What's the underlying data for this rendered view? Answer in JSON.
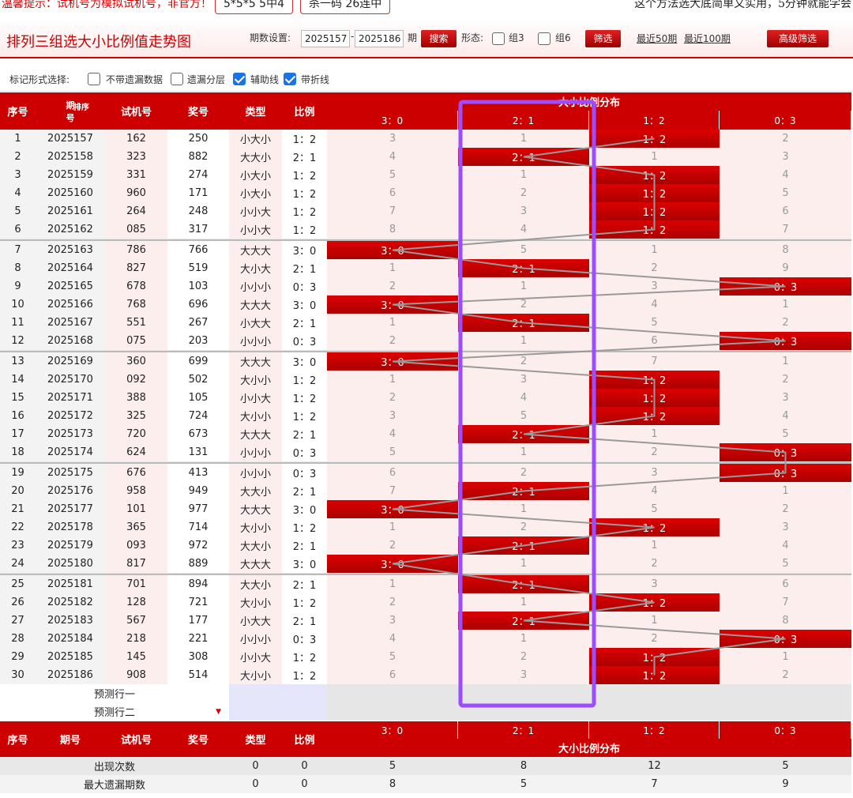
{
  "top": {
    "notice": "温馨提示：试机号为模拟试机号，非官方！",
    "pill1": "5*5*5 5中4",
    "pill2": "杀一码 26连中",
    "right": "这个方法选大底简单又实用，5分钟就能学会"
  },
  "header": {
    "title": "排列三组选大小比例值走势图",
    "period_label": "期数设置:",
    "from": "2025157",
    "dash": "-",
    "to": "2025186",
    "qi": "期",
    "search": "搜索",
    "form_label": "形态:",
    "group3": "组3",
    "group6": "组6",
    "filter": "筛选",
    "recent50": "最近50期",
    "recent100": "最近100期",
    "advanced": "高级筛选"
  },
  "marker": {
    "label": "标记形式选择:",
    "opt1": "不带遗漏数据",
    "opt2": "遗漏分层",
    "opt3": "辅助线",
    "opt4": "带折线",
    "checked": [
      false,
      false,
      true,
      true
    ]
  },
  "table": {
    "head": {
      "seq": "序号",
      "issue": "期",
      "issue2": "号",
      "sort": "排序",
      "trial": "试机号",
      "prize": "奖号",
      "type": "类型",
      "ratio": "比例",
      "dist": "大小比例分布",
      "cats": [
        "3：0",
        "2：1",
        "1：2",
        "0：3"
      ]
    },
    "rows": [
      [
        "1",
        "2025157",
        "162",
        "250",
        "小大小",
        "1：2",
        2,
        [
          3,
          1,
          null,
          2
        ]
      ],
      [
        "2",
        "2025158",
        "323",
        "882",
        "大大小",
        "2：1",
        1,
        [
          4,
          null,
          1,
          3
        ]
      ],
      [
        "3",
        "2025159",
        "331",
        "274",
        "小大小",
        "1：2",
        2,
        [
          5,
          1,
          null,
          4
        ]
      ],
      [
        "4",
        "2025160",
        "960",
        "171",
        "小大小",
        "1：2",
        2,
        [
          6,
          2,
          null,
          5
        ]
      ],
      [
        "5",
        "2025161",
        "264",
        "248",
        "小小大",
        "1：2",
        2,
        [
          7,
          3,
          null,
          6
        ]
      ],
      [
        "6",
        "2025162",
        "085",
        "317",
        "小小大",
        "1：2",
        2,
        [
          8,
          4,
          null,
          7
        ]
      ],
      [
        "7",
        "2025163",
        "786",
        "766",
        "大大大",
        "3：0",
        0,
        [
          null,
          5,
          1,
          8
        ]
      ],
      [
        "8",
        "2025164",
        "827",
        "519",
        "大小大",
        "2：1",
        1,
        [
          1,
          null,
          2,
          9
        ]
      ],
      [
        "9",
        "2025165",
        "678",
        "103",
        "小小小",
        "0：3",
        3,
        [
          2,
          1,
          3,
          null
        ]
      ],
      [
        "10",
        "2025166",
        "768",
        "696",
        "大大大",
        "3：0",
        0,
        [
          null,
          2,
          4,
          1
        ]
      ],
      [
        "11",
        "2025167",
        "551",
        "267",
        "小大大",
        "2：1",
        1,
        [
          1,
          null,
          5,
          2
        ]
      ],
      [
        "12",
        "2025168",
        "075",
        "203",
        "小小小",
        "0：3",
        3,
        [
          2,
          1,
          6,
          null
        ]
      ],
      [
        "13",
        "2025169",
        "360",
        "699",
        "大大大",
        "3：0",
        0,
        [
          null,
          2,
          7,
          1
        ]
      ],
      [
        "14",
        "2025170",
        "092",
        "502",
        "大小小",
        "1：2",
        2,
        [
          1,
          3,
          null,
          2
        ]
      ],
      [
        "15",
        "2025171",
        "388",
        "105",
        "小小大",
        "1：2",
        2,
        [
          2,
          4,
          null,
          3
        ]
      ],
      [
        "16",
        "2025172",
        "325",
        "724",
        "大小小",
        "1：2",
        2,
        [
          3,
          5,
          null,
          4
        ]
      ],
      [
        "17",
        "2025173",
        "720",
        "673",
        "大大大",
        "2：1",
        1,
        [
          4,
          null,
          1,
          5
        ]
      ],
      [
        "18",
        "2025174",
        "624",
        "131",
        "小小小",
        "0：3",
        3,
        [
          5,
          1,
          2,
          null
        ]
      ],
      [
        "19",
        "2025175",
        "676",
        "413",
        "小小小",
        "0：3",
        3,
        [
          6,
          2,
          3,
          null
        ]
      ],
      [
        "20",
        "2025176",
        "958",
        "949",
        "大大小",
        "2：1",
        1,
        [
          7,
          null,
          4,
          1
        ]
      ],
      [
        "21",
        "2025177",
        "101",
        "977",
        "大大大",
        "3：0",
        0,
        [
          null,
          1,
          5,
          2
        ]
      ],
      [
        "22",
        "2025178",
        "365",
        "714",
        "大小小",
        "1：2",
        2,
        [
          1,
          2,
          null,
          3
        ]
      ],
      [
        "23",
        "2025179",
        "093",
        "972",
        "大大小",
        "2：1",
        1,
        [
          2,
          null,
          1,
          4
        ]
      ],
      [
        "24",
        "2025180",
        "817",
        "889",
        "大大大",
        "3：0",
        0,
        [
          null,
          1,
          2,
          5
        ]
      ],
      [
        "25",
        "2025181",
        "701",
        "894",
        "大大小",
        "2：1",
        1,
        [
          1,
          null,
          3,
          6
        ]
      ],
      [
        "26",
        "2025182",
        "128",
        "721",
        "大小小",
        "1：2",
        2,
        [
          2,
          1,
          null,
          7
        ]
      ],
      [
        "27",
        "2025183",
        "567",
        "177",
        "小大大",
        "2：1",
        1,
        [
          3,
          null,
          1,
          8
        ]
      ],
      [
        "28",
        "2025184",
        "218",
        "221",
        "小小小",
        "0：3",
        3,
        [
          4,
          1,
          2,
          null
        ]
      ],
      [
        "29",
        "2025185",
        "145",
        "308",
        "小小大",
        "1：2",
        2,
        [
          5,
          2,
          null,
          1
        ]
      ],
      [
        "30",
        "2025186",
        "908",
        "514",
        "大小小",
        "1：2",
        2,
        [
          6,
          3,
          null,
          2
        ]
      ]
    ],
    "predict1": "预测行一",
    "predict2": "预测行二",
    "foot": {
      "seq": "序号",
      "issue": "期号",
      "trial": "试机号",
      "prize": "奖号",
      "type": "类型",
      "ratio": "比例",
      "cats": [
        "3：0",
        "2：1",
        "1：2",
        "0：3"
      ],
      "dist": "大小比例分布"
    },
    "stats": [
      {
        "label": "出现次数",
        "a": "0",
        "b": "0",
        "v": [
          "5",
          "8",
          "12",
          "5"
        ]
      },
      {
        "label": "最大遗漏期数",
        "a": "0",
        "b": "0",
        "v": [
          "8",
          "5",
          "7",
          "9"
        ]
      }
    ]
  },
  "colors": {
    "accent": "#cc0000",
    "highlight": "#9b4dff",
    "missBg": "#fdeeee",
    "grayRow": "#efefef"
  }
}
